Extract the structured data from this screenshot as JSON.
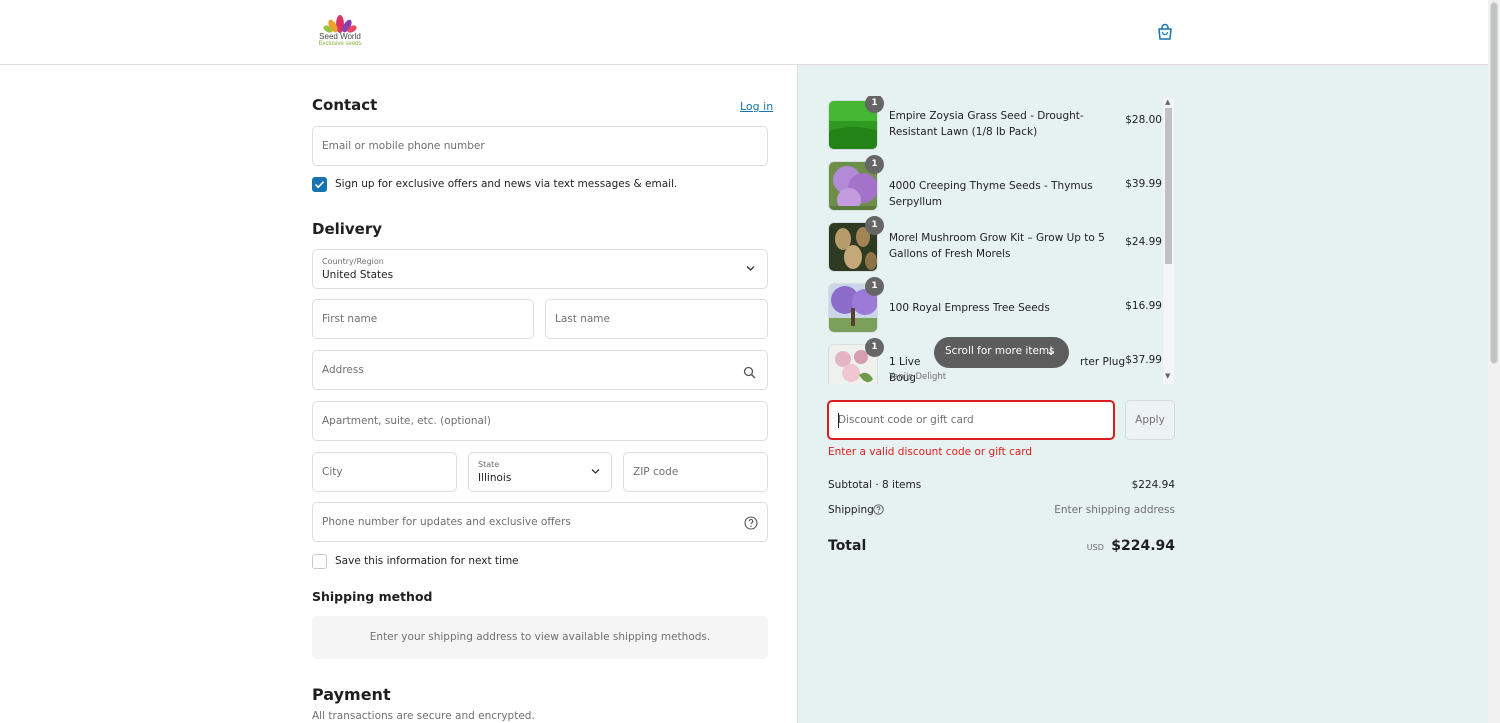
{
  "header": {
    "logo_name": "Seed World",
    "logo_tagline": "Exclusive seeds",
    "cart_icon": "shopping-bag-icon"
  },
  "contact": {
    "title": "Contact",
    "login_link": "Log in",
    "email_placeholder": "Email or mobile phone number",
    "newsletter_label": "Sign up for exclusive offers and news via text messages & email.",
    "newsletter_checked": true
  },
  "delivery": {
    "title": "Delivery",
    "country_label": "Country/Region",
    "country_value": "United States",
    "first_name_placeholder": "First name",
    "last_name_placeholder": "Last name",
    "address_placeholder": "Address",
    "apartment_placeholder": "Apartment, suite, etc. (optional)",
    "city_placeholder": "City",
    "state_label": "State",
    "state_value": "Illinois",
    "zip_placeholder": "ZIP code",
    "phone_placeholder": "Phone number for updates and exclusive offers",
    "save_info_label": "Save this information for next time",
    "save_info_checked": false
  },
  "shipping_method": {
    "title": "Shipping method",
    "message": "Enter your shipping address to view available shipping methods."
  },
  "payment": {
    "title": "Payment",
    "subtitle": "All transactions are secure and encrypted."
  },
  "cart": {
    "items": [
      {
        "title": "Empire Zoysia Grass Seed - Drought-Resistant Lawn (1/8 lb Pack)",
        "price": "$28.00",
        "quantity": "1",
        "color": "#3aa428"
      },
      {
        "title": "4000 Creeping Thyme Seeds - Thymus Serpyllum",
        "price": "$39.99",
        "quantity": "1",
        "color": "#a779c9"
      },
      {
        "title": "Morel Mushroom Grow Kit – Grow Up to 5 Gallons of Fresh Morels",
        "price": "$24.99",
        "quantity": "1",
        "color": "#6b5a3a"
      },
      {
        "title": "100 Royal Empress Tree Seeds",
        "price": "$16.99",
        "quantity": "1",
        "color": "#9b78d4"
      },
      {
        "title": "1 Live Bougainvillea Starter Plug",
        "title_visible_start": "1 Live Boug",
        "title_visible_end": "rter Plug",
        "variant": "Yani's Delight",
        "price": "$37.99",
        "quantity": "1",
        "color": "#d8a6b8"
      }
    ],
    "scroll_hint": "Scroll for more items",
    "discount_placeholder": "Discount code or gift card",
    "apply_label": "Apply",
    "discount_error": "Enter a valid discount code or gift card",
    "subtotal_label": "Subtotal · 8 items",
    "subtotal_value": "$224.94",
    "shipping_label": "Shipping",
    "shipping_value": "Enter shipping address",
    "total_label": "Total",
    "currency": "USD",
    "total_value": "$224.94"
  },
  "colors": {
    "accent": "#1773b0",
    "error": "#dd1d1d",
    "summary_bg": "#e6f1f2"
  }
}
